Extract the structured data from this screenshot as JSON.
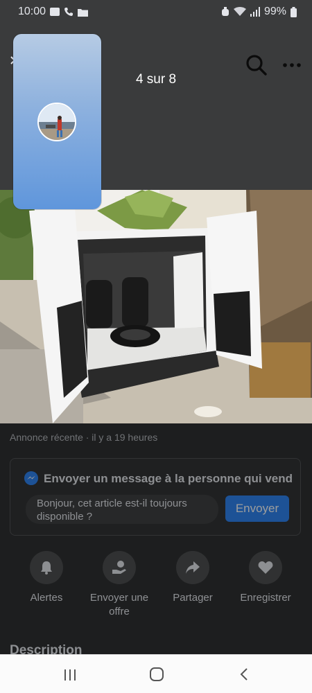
{
  "status_bar": {
    "time": "10:00",
    "battery": "99%",
    "icons": [
      "image-icon",
      "phone-icon",
      "folder-icon",
      "alarm-icon",
      "wifi-icon",
      "signal-icon",
      "battery-icon"
    ]
  },
  "viewer": {
    "counter": "4 sur 8"
  },
  "listing": {
    "recent": "Annonce récente · il y a 19 heures",
    "message_card": {
      "title": "Envoyer un message à la personne qui vend",
      "input_value": "Bonjour, cet article est-il toujours disponible ?",
      "send_label": "Envoyer"
    },
    "actions": [
      {
        "label": "Alertes",
        "icon": "bell-icon"
      },
      {
        "label": "Envoyer une offre",
        "icon": "offer-icon"
      },
      {
        "label": "Partager",
        "icon": "share-icon"
      },
      {
        "label": "Enregistrer",
        "icon": "heart-icon"
      }
    ],
    "description_title": "Description"
  },
  "colors": {
    "accent": "#1877f2",
    "background": "#242526",
    "nav_bar": "#fbfbfb"
  }
}
